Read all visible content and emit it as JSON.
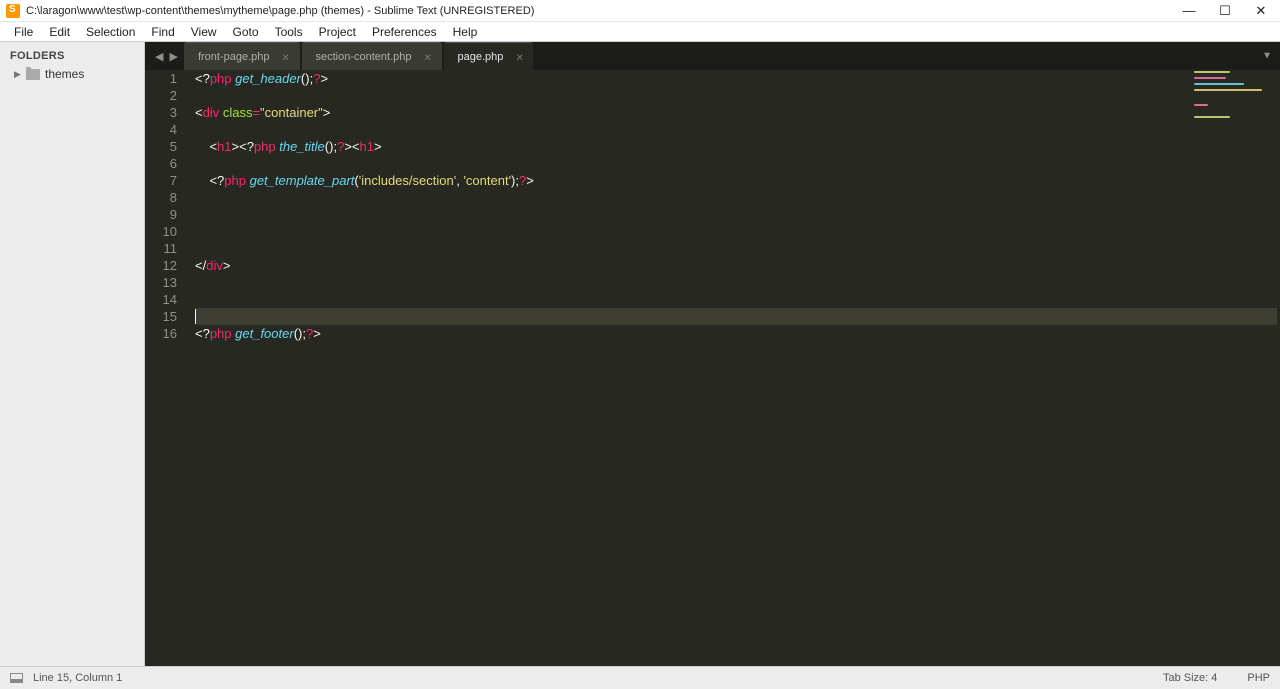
{
  "title": "C:\\laragon\\www\\test\\wp-content\\themes\\mytheme\\page.php (themes) - Sublime Text (UNREGISTERED)",
  "menu": [
    "File",
    "Edit",
    "Selection",
    "Find",
    "View",
    "Goto",
    "Tools",
    "Project",
    "Preferences",
    "Help"
  ],
  "sidebar": {
    "header": "FOLDERS",
    "item": "themes"
  },
  "tabs": [
    {
      "label": "front-page.php",
      "active": false
    },
    {
      "label": "section-content.php",
      "active": false
    },
    {
      "label": "page.php",
      "active": true
    }
  ],
  "code": {
    "lines": 16,
    "cursor_line": 15,
    "line1": [
      [
        "cw",
        "<?"
      ],
      [
        "ctag",
        "php "
      ],
      [
        "cfn",
        "get_header"
      ],
      [
        "cw",
        "();"
      ],
      [
        "ctag",
        "?"
      ],
      [
        "cw",
        ">"
      ]
    ],
    "line3": [
      [
        "cw",
        "<"
      ],
      [
        "ckw",
        "div "
      ],
      [
        "cattr",
        "class"
      ],
      [
        "cop",
        "="
      ],
      [
        "cstr",
        "\"container\""
      ],
      [
        "cw",
        ">"
      ]
    ],
    "line5": [
      [
        "cw",
        "    <"
      ],
      [
        "ckw",
        "h1"
      ],
      [
        "cw",
        "><?"
      ],
      [
        "ctag",
        "php "
      ],
      [
        "cfn",
        "the_title"
      ],
      [
        "cw",
        "();"
      ],
      [
        "ctag",
        "?"
      ],
      [
        "cw",
        "><"
      ],
      [
        "ckw",
        "h1"
      ],
      [
        "cw",
        ">"
      ]
    ],
    "line7": [
      [
        "cw",
        "    <?"
      ],
      [
        "ctag",
        "php "
      ],
      [
        "cfn",
        "get_template_part"
      ],
      [
        "cw",
        "("
      ],
      [
        "cstr",
        "'includes/section'"
      ],
      [
        "cw",
        ", "
      ],
      [
        "cstr",
        "'content'"
      ],
      [
        "cw",
        ");"
      ],
      [
        "ctag",
        "?"
      ],
      [
        "cw",
        ">"
      ]
    ],
    "line12": [
      [
        "cw",
        "</"
      ],
      [
        "ckw",
        "div"
      ],
      [
        "cw",
        ">"
      ]
    ],
    "line16": [
      [
        "cw",
        "<?"
      ],
      [
        "ctag",
        "php "
      ],
      [
        "cfn",
        "get_footer"
      ],
      [
        "cw",
        "();"
      ],
      [
        "ctag",
        "?"
      ],
      [
        "cw",
        ">"
      ]
    ]
  },
  "status": {
    "pos": "Line 15, Column 1",
    "tabsize": "Tab Size: 4",
    "lang": "PHP"
  }
}
